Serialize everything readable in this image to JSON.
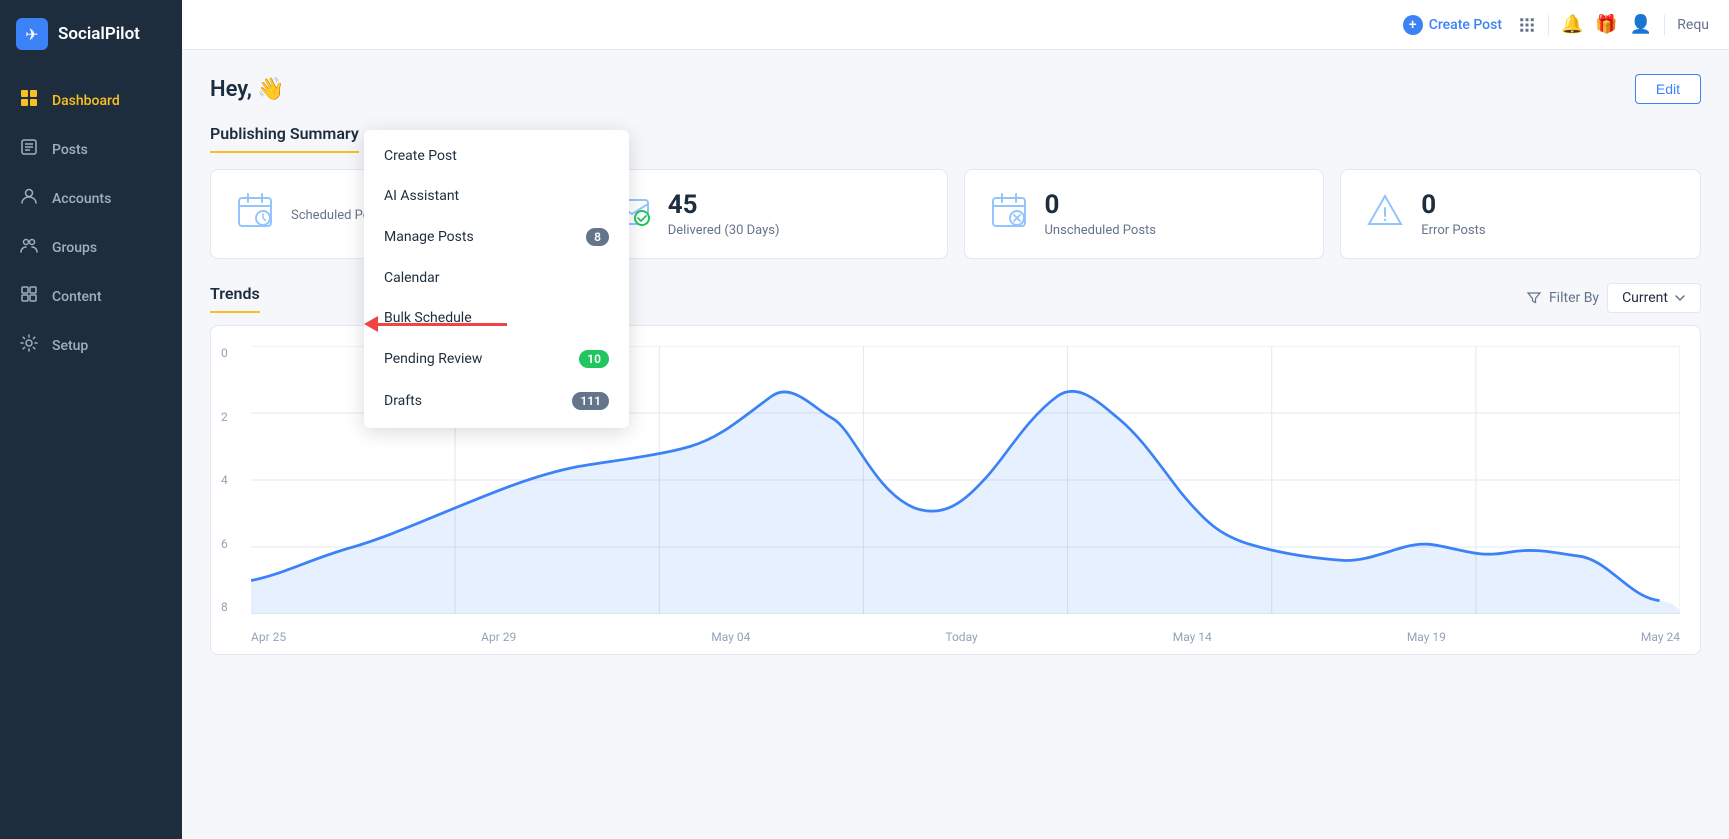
{
  "app": {
    "name": "SocialPilot",
    "logo_char": "✈"
  },
  "topbar": {
    "create_post_label": "Create Post",
    "requ_label": "Requ"
  },
  "sidebar": {
    "items": [
      {
        "id": "dashboard",
        "label": "Dashboard",
        "icon": "⊞",
        "active": true
      },
      {
        "id": "posts",
        "label": "Posts",
        "icon": "📝",
        "active": false
      },
      {
        "id": "accounts",
        "label": "Accounts",
        "icon": "⚙",
        "active": false
      },
      {
        "id": "groups",
        "label": "Groups",
        "icon": "👥",
        "active": false
      },
      {
        "id": "content",
        "label": "Content",
        "icon": "📄",
        "active": false
      },
      {
        "id": "setup",
        "label": "Setup",
        "icon": "🔧",
        "active": false
      }
    ]
  },
  "header": {
    "greeting": "Hey, 👋",
    "edit_label": "Edit"
  },
  "publishing_summary": {
    "title": "Publishing Summary",
    "stats": [
      {
        "id": "scheduled",
        "number": "",
        "label": "Scheduled Posts",
        "icon": "📅"
      },
      {
        "id": "delivered",
        "number": "45",
        "label": "Delivered (30 Days)",
        "icon": "✉"
      },
      {
        "id": "unscheduled",
        "number": "0",
        "label": "Unscheduled Posts",
        "icon": "📵"
      },
      {
        "id": "error",
        "number": "0",
        "label": "Error Posts",
        "icon": "⚠"
      }
    ]
  },
  "trends": {
    "title": "Trends",
    "filter_label": "Filter By",
    "filter_current": "Current",
    "chart": {
      "y_labels": [
        "0",
        "2",
        "4",
        "6",
        "8"
      ],
      "x_labels": [
        "Apr 25",
        "Apr 29",
        "May 04",
        "Today",
        "May 14",
        "May 19",
        "May 24"
      ],
      "line_color": "#3b82f6",
      "fill_color": "rgba(59,130,246,0.15)"
    }
  },
  "dropdown": {
    "items": [
      {
        "id": "create-post",
        "label": "Create Post",
        "badge": null
      },
      {
        "id": "ai-assistant",
        "label": "AI Assistant",
        "badge": null
      },
      {
        "id": "manage-posts",
        "label": "Manage Posts",
        "badge": "8",
        "badge_color": "gray"
      },
      {
        "id": "calendar",
        "label": "Calendar",
        "badge": null
      },
      {
        "id": "bulk-schedule",
        "label": "Bulk Schedule",
        "badge": null,
        "highlighted": true
      },
      {
        "id": "pending-review",
        "label": "Pending Review",
        "badge": "10",
        "badge_color": "green"
      },
      {
        "id": "drafts",
        "label": "Drafts",
        "badge": "111",
        "badge_color": "gray"
      }
    ]
  }
}
